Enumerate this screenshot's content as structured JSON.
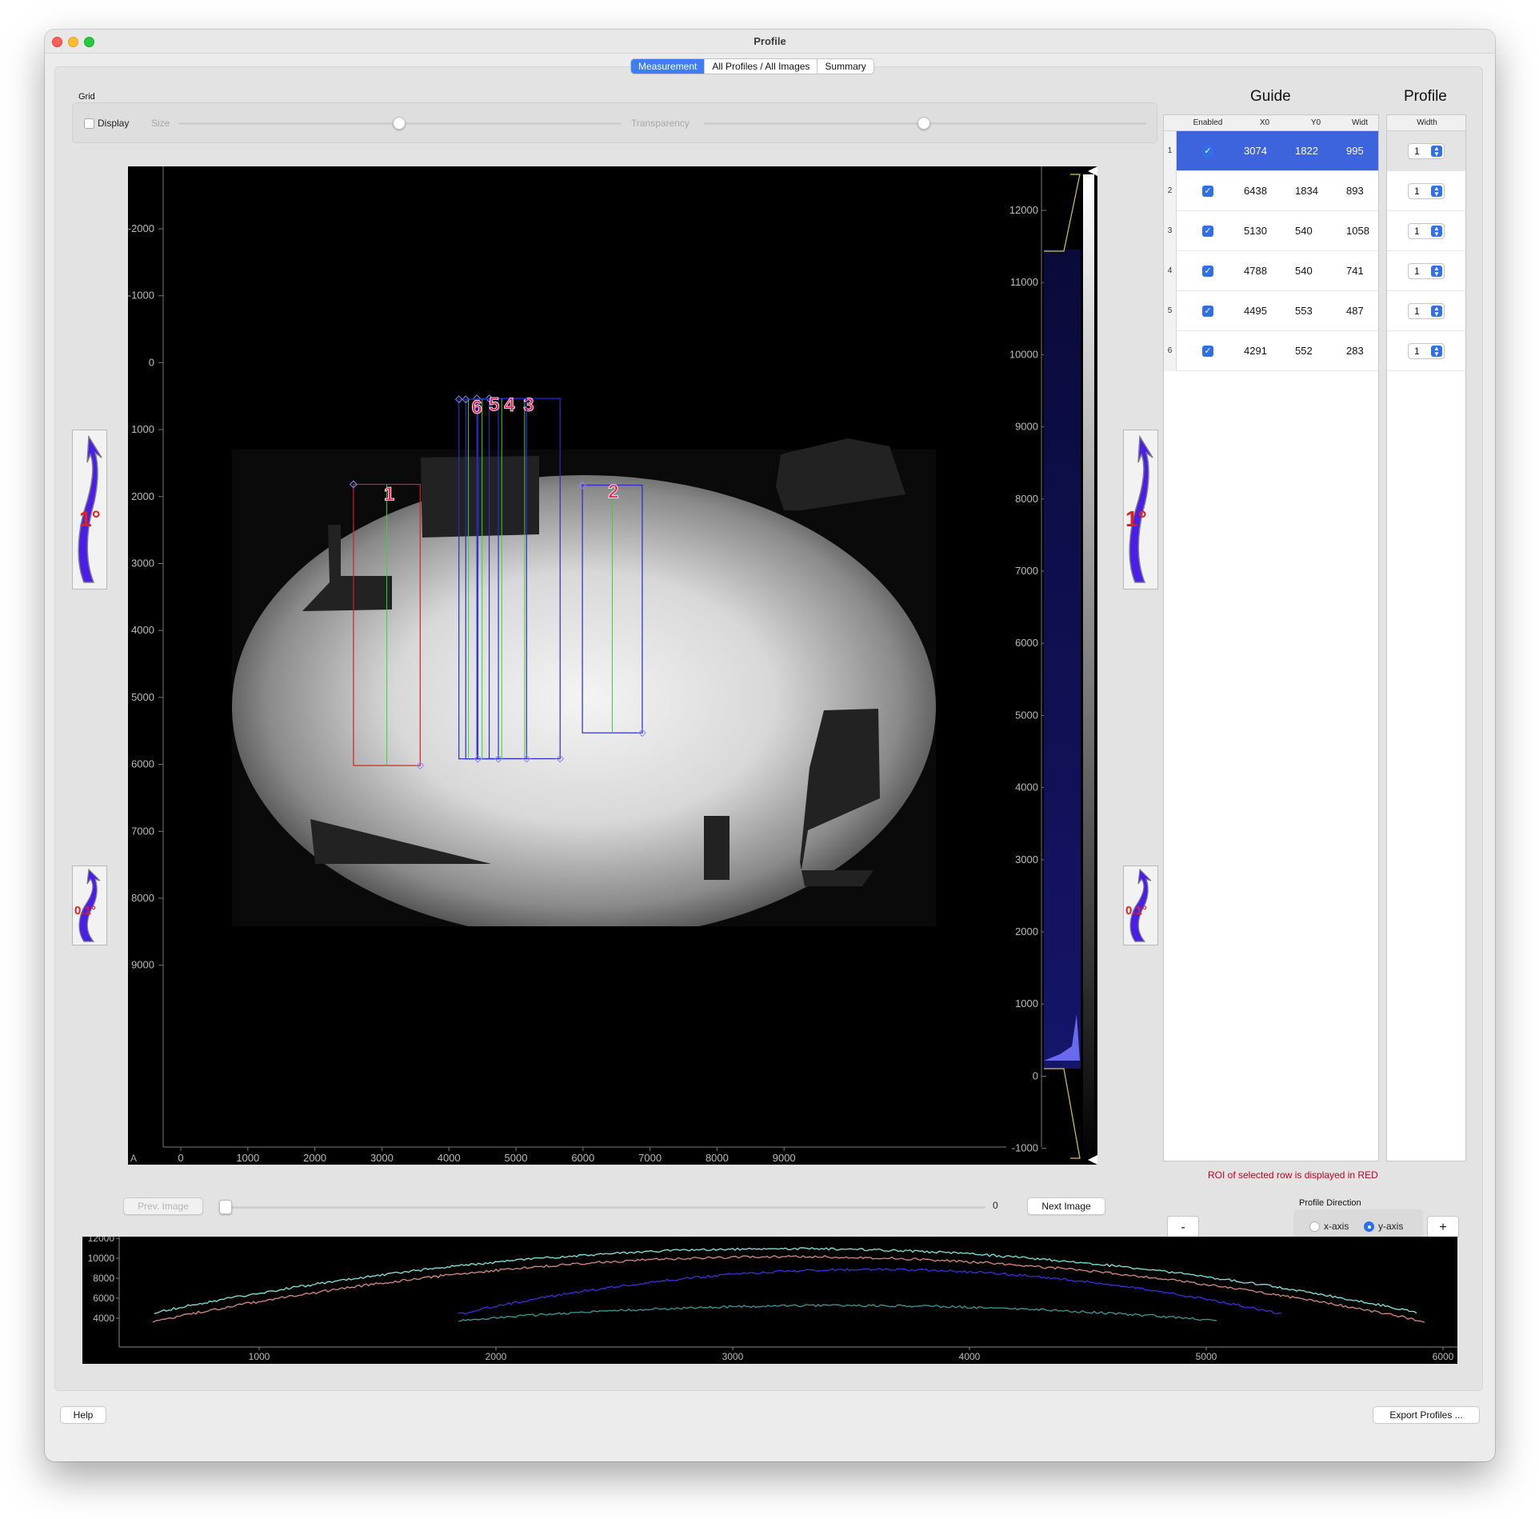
{
  "window": {
    "title": "Profile"
  },
  "tabs": [
    {
      "label": "Measurement",
      "active": true
    },
    {
      "label": "All Profiles / All Images",
      "active": false
    },
    {
      "label": "Summary",
      "active": false
    }
  ],
  "grid": {
    "label": "Grid",
    "display_label": "Display",
    "display_checked": false,
    "size_label": "Size",
    "size_value": 0.5,
    "transparency_label": "Transparency",
    "transparency_value": 0.5
  },
  "image": {
    "left_axis_ticks": [
      "-2000",
      "-1000",
      "0",
      "1000",
      "2000",
      "3000",
      "4000",
      "5000",
      "6000",
      "7000",
      "8000",
      "9000"
    ],
    "bottom_axis_ticks": [
      "0",
      "1000",
      "2000",
      "3000",
      "4000",
      "5000",
      "6000",
      "7000",
      "8000",
      "9000"
    ],
    "histogram_ticks": [
      "12000",
      "11000",
      "10000",
      "9000",
      "8000",
      "7000",
      "6000",
      "5000",
      "4000",
      "3000",
      "2000",
      "1000",
      "0",
      "-1000"
    ],
    "corner_label": "A",
    "roi_labels": [
      "1",
      "2",
      "3",
      "4",
      "5",
      "6"
    ],
    "colors": {
      "selected_roi": "#d42020",
      "roi": "#2a2ac8",
      "guide": "#3ad23a",
      "label": "#e8205a"
    }
  },
  "rotate_buttons": {
    "large_label": "1°",
    "small_label": "0.1°"
  },
  "navigation": {
    "prev_label": "Prev. Image",
    "next_label": "Next Image",
    "index_value": "0"
  },
  "guide": {
    "title": "Guide",
    "columns": [
      "Enabled",
      "X0",
      "Y0",
      "Widt"
    ],
    "rows": [
      {
        "num": "1",
        "x0": "3074",
        "y0": "1822",
        "w": "995",
        "selected": true
      },
      {
        "num": "2",
        "x0": "6438",
        "y0": "1834",
        "w": "893"
      },
      {
        "num": "3",
        "x0": "5130",
        "y0": "540",
        "w": "1058"
      },
      {
        "num": "4",
        "x0": "4788",
        "y0": "540",
        "w": "741"
      },
      {
        "num": "5",
        "x0": "4495",
        "y0": "553",
        "w": "487"
      },
      {
        "num": "6",
        "x0": "4291",
        "y0": "552",
        "w": "283"
      }
    ]
  },
  "profile": {
    "title": "Profile",
    "column": "Width",
    "widths": [
      "1",
      "1",
      "1",
      "1",
      "1",
      "1"
    ]
  },
  "roi_note": "ROI of selected row is displayed in RED",
  "profile_direction": {
    "label": "Profile Direction",
    "options": [
      "x-axis",
      "y-axis"
    ],
    "selected": "y-axis"
  },
  "buttons": {
    "minus": "-",
    "plus": "+",
    "help": "Help",
    "export": "Export Profiles ..."
  },
  "profile_plot": {
    "y_ticks": [
      "12000",
      "10000",
      "8000",
      "6000",
      "4000"
    ],
    "x_ticks": [
      "1000",
      "2000",
      "3000",
      "4000",
      "5000",
      "6000"
    ],
    "colors": [
      "#7fe8e0",
      "#d88a80",
      "#3a30e0",
      "#3a9a98"
    ]
  }
}
